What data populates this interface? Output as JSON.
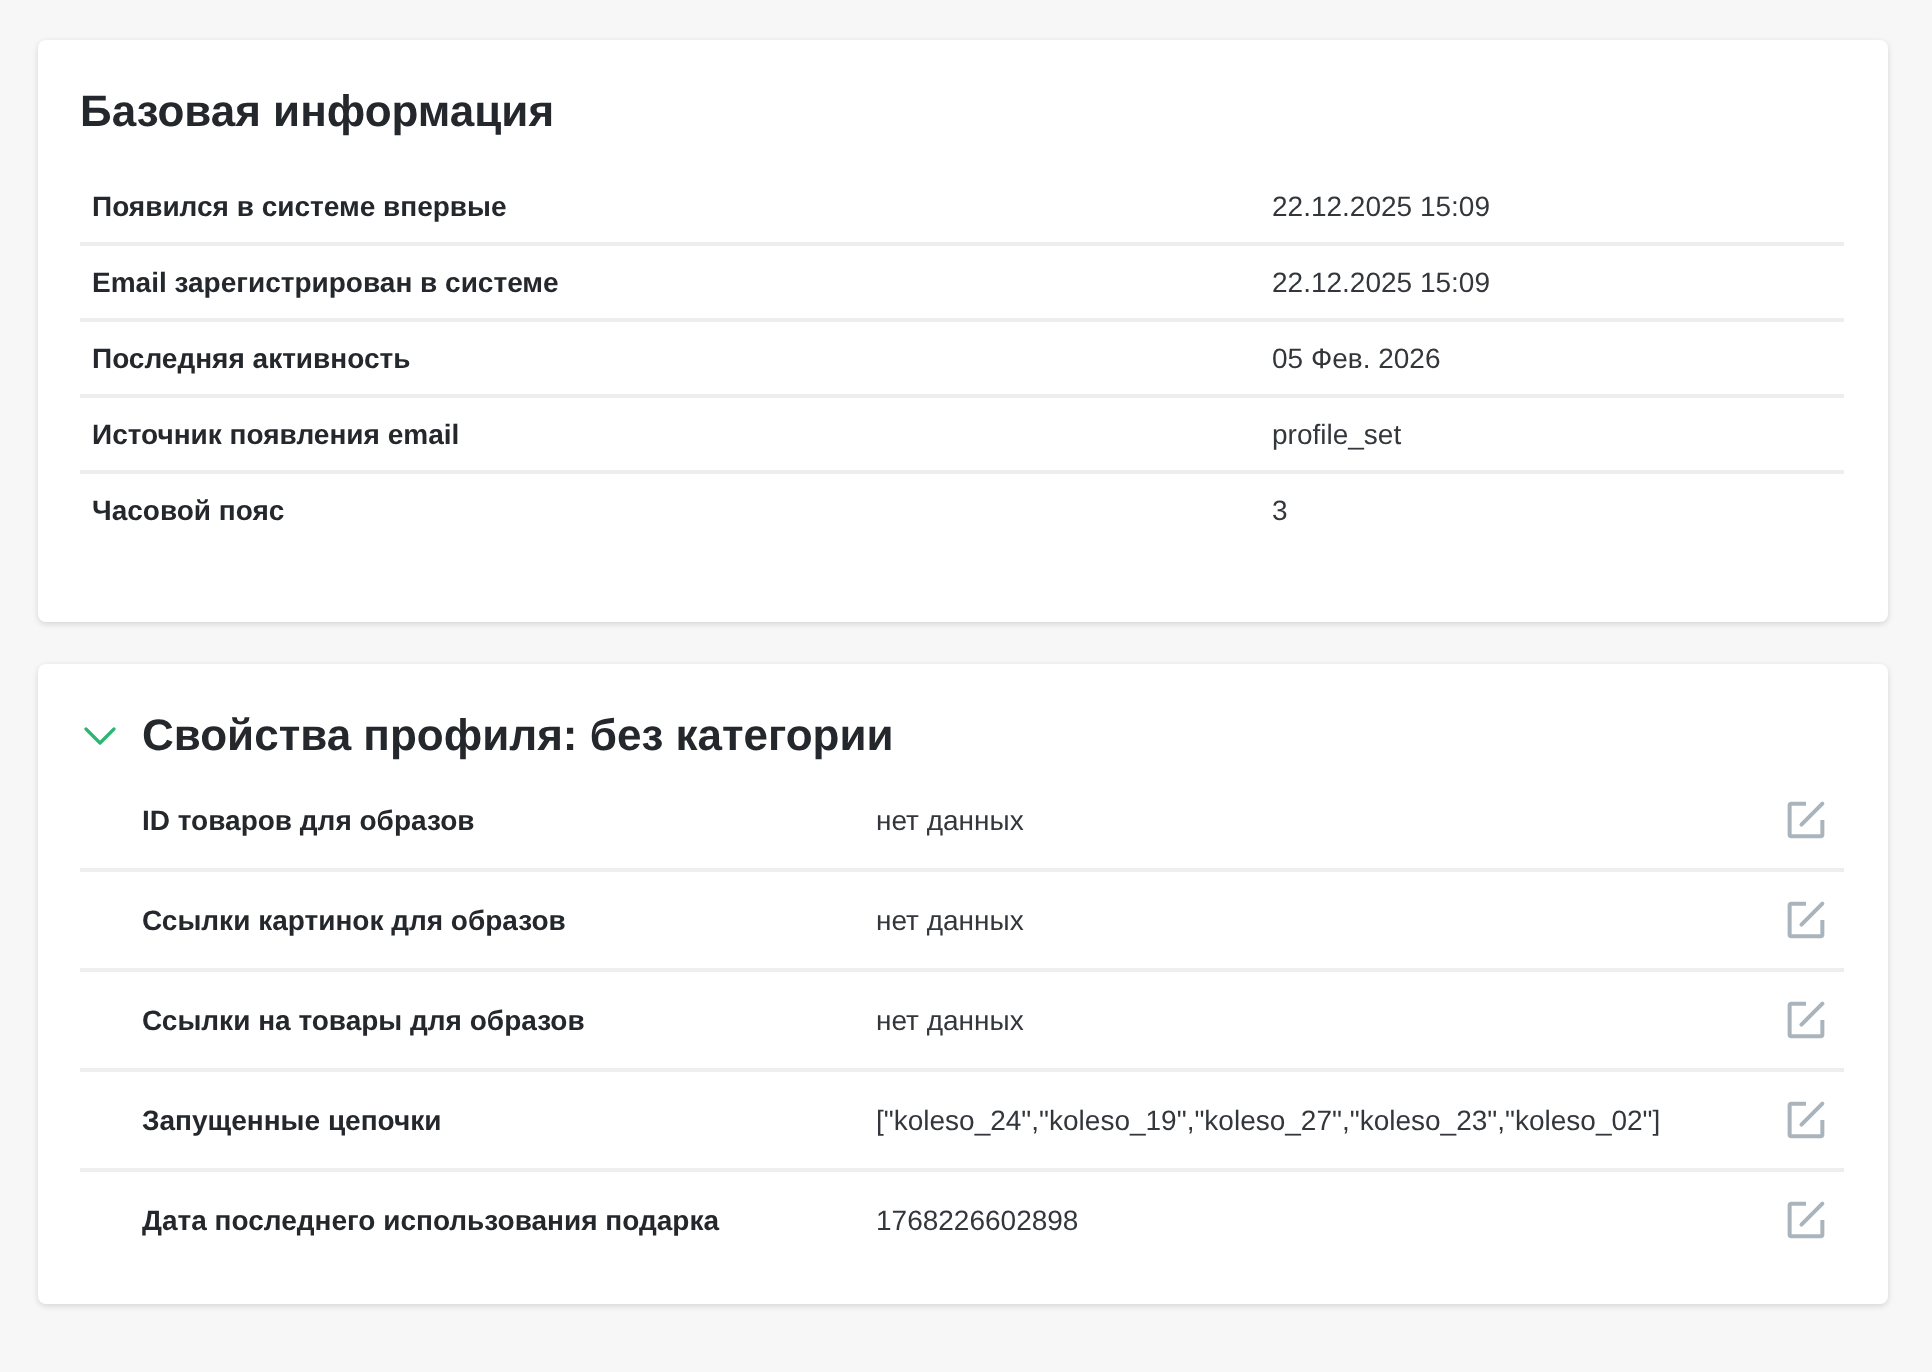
{
  "basic_info": {
    "title": "Базовая информация",
    "rows": [
      {
        "label": "Появился в системе впервые",
        "value": "22.12.2025 15:09"
      },
      {
        "label": "Email зарегистрирован в системе",
        "value": "22.12.2025 15:09"
      },
      {
        "label": "Последняя активность",
        "value": "05 Фев. 2026"
      },
      {
        "label": "Источник появления email",
        "value": "profile_set"
      },
      {
        "label": "Часовой пояс",
        "value": "3"
      }
    ]
  },
  "profile_properties": {
    "title": "Свойства профиля: без категории",
    "expanded": true,
    "rows": [
      {
        "label": "ID товаров для образов",
        "value": "нет данных"
      },
      {
        "label": "Ссылки картинок для образов",
        "value": "нет данных"
      },
      {
        "label": "Ссылки на товары для образов",
        "value": "нет данных"
      },
      {
        "label": "Запущенные цепочки",
        "value": "[\"koleso_24\",\"koleso_19\",\"koleso_27\",\"koleso_23\",\"koleso_02\"]"
      },
      {
        "label": "Дата последнего использования подарка",
        "value": "1768226602898"
      }
    ]
  }
}
